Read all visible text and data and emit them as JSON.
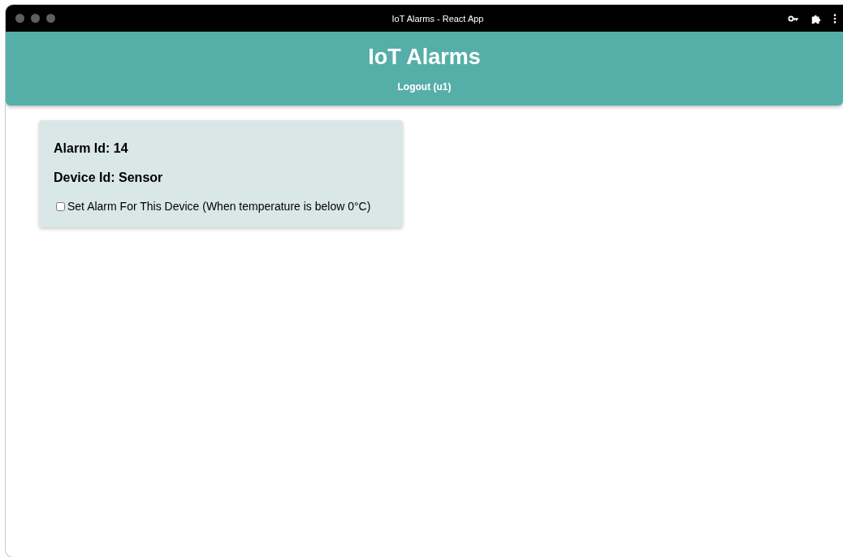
{
  "window": {
    "title": "IoT Alarms - React App"
  },
  "header": {
    "title": "IoT Alarms",
    "logout": "Logout (u1)"
  },
  "alarms": [
    {
      "alarm_id": "Alarm Id: 14",
      "device_id": "Device Id: Sensor",
      "checkbox": {
        "label": "Set Alarm For This Device (When temperature is below 0°C)",
        "checked": false
      }
    }
  ]
}
